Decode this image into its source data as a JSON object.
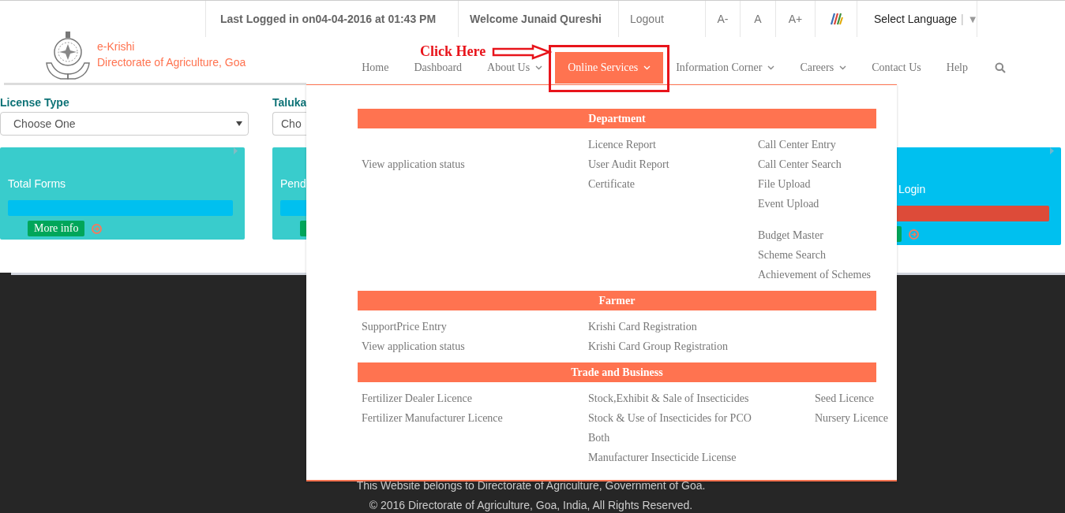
{
  "top_bar": {
    "last_logged": "Last Logged in on04-04-2016 at 01:43 PM",
    "welcome": "Welcome Junaid Qureshi",
    "logout": "Logout",
    "font_sizes": [
      "A-",
      "A",
      "A+"
    ],
    "language": {
      "label": "Select Language",
      "separator": "|",
      "caret": "▼"
    }
  },
  "brand": {
    "name": "e-Krishi",
    "subtitle": "Directorate of Agriculture, Goa"
  },
  "nav": [
    {
      "label": "Home",
      "has_dropdown": false,
      "selected": false
    },
    {
      "label": "Dashboard",
      "has_dropdown": false,
      "selected": false
    },
    {
      "label": "About Us",
      "has_dropdown": true,
      "selected": false
    },
    {
      "label": "Online Services",
      "has_dropdown": true,
      "selected": true
    },
    {
      "label": "Information Corner",
      "has_dropdown": true,
      "selected": false
    },
    {
      "label": "Careers",
      "has_dropdown": true,
      "selected": false
    },
    {
      "label": "Contact Us",
      "has_dropdown": false,
      "selected": false
    },
    {
      "label": "Help",
      "has_dropdown": false,
      "selected": false
    }
  ],
  "annotation": {
    "text": "Click Here"
  },
  "filters": [
    {
      "kind": "whole",
      "label": "License Type",
      "value": "Choose One"
    },
    {
      "kind": "right-edge",
      "label": "Taluka",
      "value": "Cho"
    }
  ],
  "cards": [
    {
      "kind": "whole",
      "title": "Total Forms",
      "color": "#39cccc",
      "bar": {
        "color": "#00c0ef"
      },
      "button": "More info"
    },
    {
      "kind": "right-edge",
      "title": "Pend",
      "color": "#39cccc",
      "bar": {
        "color": "#00c0ef"
      }
    },
    {
      "kind": "left-edge",
      "title": "Login",
      "color": "#00c0ef",
      "bar": {
        "color": "#dd4b39"
      }
    }
  ],
  "menu": {
    "sections": [
      {
        "title": "Department",
        "columns": [
          [
            [
              "View application status"
            ]
          ],
          [
            [
              "Licence Report",
              "User Audit Report",
              "Certificate"
            ]
          ],
          [
            [
              "Call Center Entry",
              "Call Center Search",
              "File Upload",
              "Event Upload"
            ],
            [
              "Budget Master",
              "Scheme Search",
              "Achievement of Schemes"
            ]
          ]
        ]
      },
      {
        "title": "Farmer",
        "columns": [
          [
            [
              "SupportPrice Entry",
              "View application status"
            ]
          ],
          [
            [
              "Krishi Card Registration",
              "Krishi Card Group Registration"
            ]
          ]
        ]
      },
      {
        "title": "Trade and Business",
        "columns": [
          [
            [
              "Fertilizer Dealer Licence",
              "Fertilizer Manufacturer Licence"
            ]
          ],
          [
            [
              "Stock,Exhibit & Sale of Insecticides",
              "Stock & Use of Insecticides for PCO",
              "Both",
              "Manufacturer Insecticide License"
            ]
          ],
          [
            [
              "Seed Licence",
              "Nursery Licence"
            ]
          ]
        ]
      }
    ]
  },
  "footer": {
    "lines": [
      "This Website belongs to Directorate of Agriculture, Government of Goa.",
      "© 2016 Directorate of Agriculture, Goa, India, All Rights Reserved."
    ]
  }
}
